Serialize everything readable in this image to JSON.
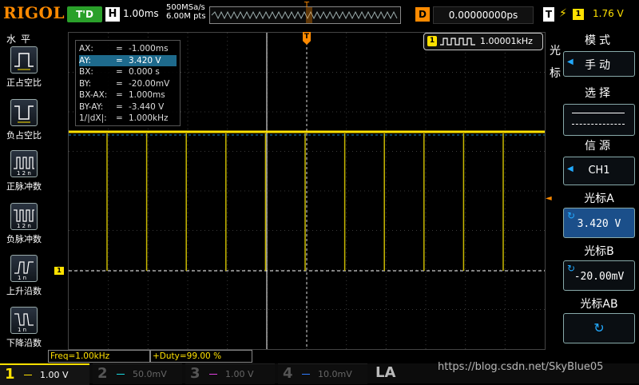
{
  "top": {
    "logo": "RIGOL",
    "run_status": "T'D",
    "h_badge": "H",
    "timebase": "1.00ms",
    "sample_rate": "500MSa/s",
    "mem_depth": "6.00M pts",
    "trigger_pos_marker": "T",
    "delay_badge": "D",
    "delay_value": "0.00000000ps",
    "trig_badge": "T",
    "trig_edge": "⚡",
    "trig_channel": "1",
    "trig_level": "1.76 V"
  },
  "left_panel": {
    "title": "水平",
    "items": [
      {
        "label": "正占空比",
        "icon": "positive-duty-icon"
      },
      {
        "label": "负占空比",
        "icon": "negative-duty-icon"
      },
      {
        "label": "正脉冲数",
        "icon": "positive-pulse-count-icon"
      },
      {
        "label": "负脉冲数",
        "icon": "negative-pulse-count-icon"
      },
      {
        "label": "上升沿数",
        "icon": "rising-edge-count-icon"
      },
      {
        "label": "下降沿数",
        "icon": "falling-edge-count-icon"
      }
    ]
  },
  "cursor_table": [
    {
      "key": "AX:",
      "eq": "=",
      "val": "-1.000ms"
    },
    {
      "key": "AY:",
      "eq": "=",
      "val": "3.420 V"
    },
    {
      "key": "BX:",
      "eq": "=",
      "val": "0.000 s"
    },
    {
      "key": "BY:",
      "eq": "=",
      "val": "-20.00mV"
    },
    {
      "key": "BX-AX:",
      "eq": "=",
      "val": "1.000ms"
    },
    {
      "key": "BY-AY:",
      "eq": "=",
      "val": "-3.440 V"
    },
    {
      "key": "1/|dX|:",
      "eq": "=",
      "val": "1.000kHz"
    }
  ],
  "freq_counter": {
    "channel": "1",
    "value": "1.00001kHz"
  },
  "side_label": "光标",
  "right_menu": {
    "mode_title": "模式",
    "mode_value": "手动",
    "select_title": "选择",
    "source_title": "信源",
    "source_value": "CH1",
    "cursorA_title": "光标A",
    "cursorA_value": "3.420 V",
    "cursorB_title": "光标B",
    "cursorB_value": "-20.00mV",
    "cursorAB_title": "光标AB"
  },
  "markers": {
    "ch1_ground": "1",
    "cursor_a": "◄"
  },
  "status": {
    "freq": "Freq=1.00kHz",
    "duty": "+Duty=99.00 %"
  },
  "bottom": {
    "channels": [
      {
        "num": "1",
        "value": "1.00 V",
        "color": "#ffe100"
      },
      {
        "num": "2",
        "value": "50.0mV",
        "color": "#18d8e0"
      },
      {
        "num": "3",
        "value": "1.00 V",
        "color": "#e040e0"
      },
      {
        "num": "4",
        "value": "10.0mV",
        "color": "#2f7bff"
      }
    ],
    "la": "LA"
  },
  "watermark": "https://blog.csdn.net/SkyBlue05",
  "colors": {
    "ch1": "#ffe100",
    "accent": "#ff8a00",
    "menu_blue": "#1b4f8a"
  }
}
